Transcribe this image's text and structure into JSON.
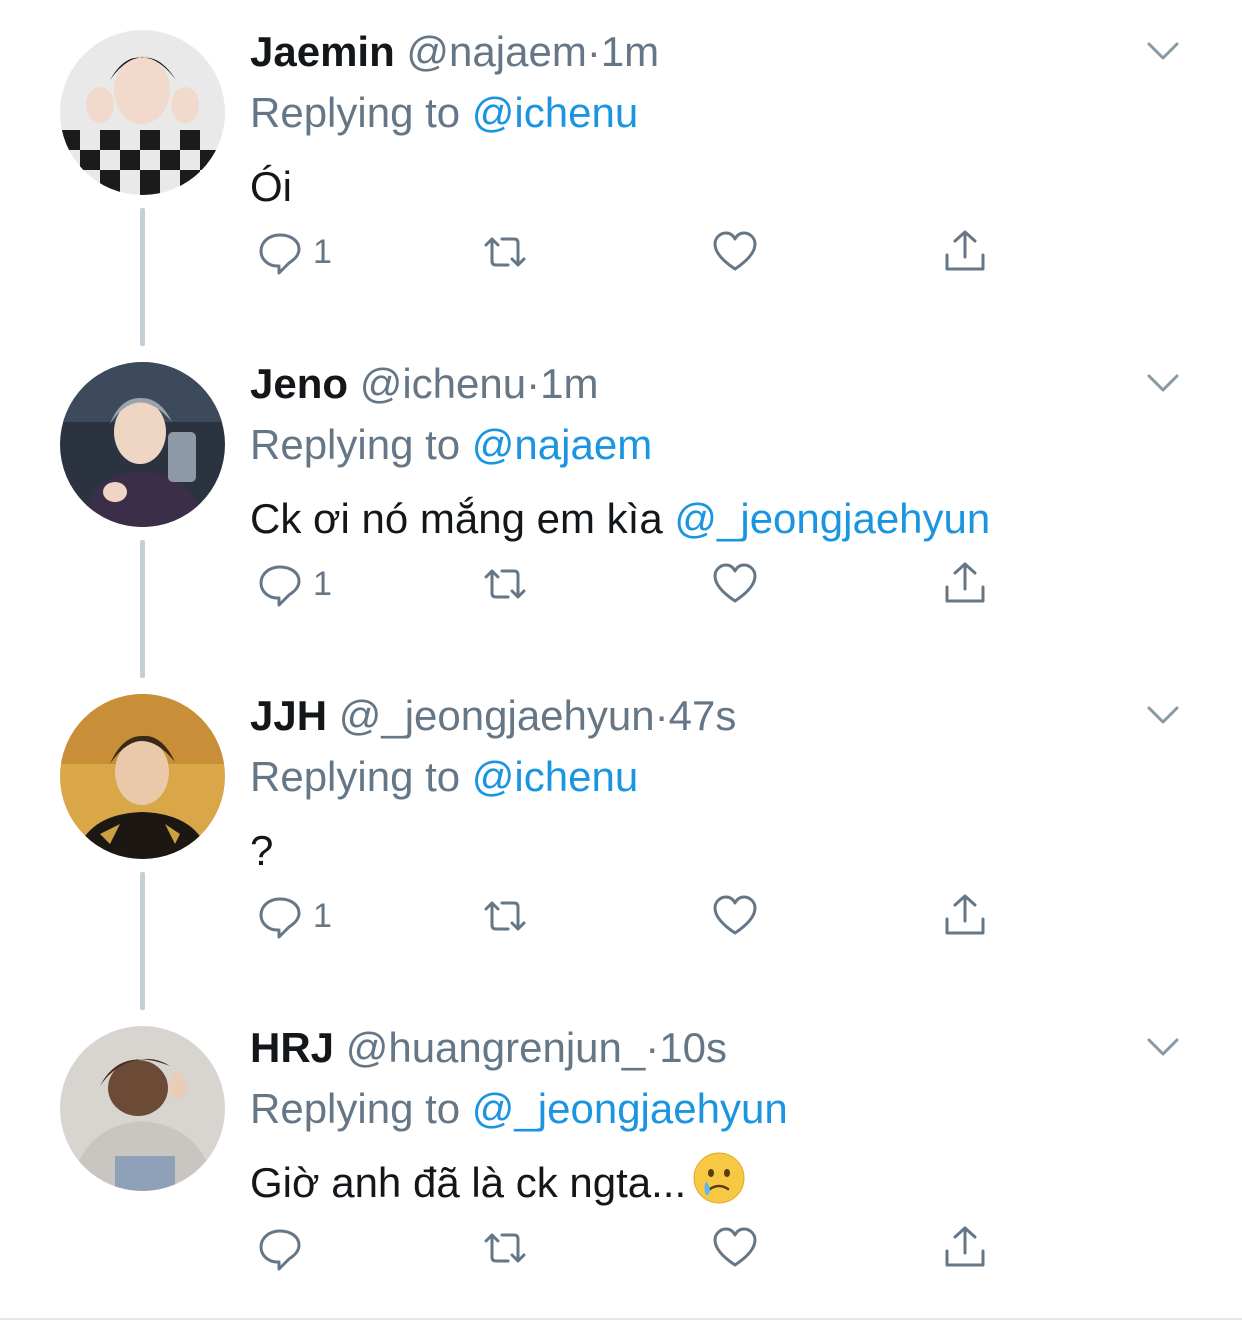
{
  "colors": {
    "text": "#14171a",
    "secondary": "#657786",
    "mention": "#1b95e0",
    "thread_line": "#c4cfd6"
  },
  "tweets": [
    {
      "name": "Jaemin",
      "handle": "@najaem",
      "separator": "·",
      "time": "1m",
      "replying_prefix": "Replying to",
      "replying_to": "@ichenu",
      "text": "Ói",
      "text_mention": "",
      "reply_count": "1"
    },
    {
      "name": "Jeno",
      "handle": "@ichenu",
      "separator": "·",
      "time": "1m",
      "replying_prefix": "Replying to",
      "replying_to": "@najaem",
      "text": "Ck ơi nó mắng em kìa",
      "text_mention": "@_jeongjaehyun",
      "reply_count": "1"
    },
    {
      "name": "JJH",
      "handle": "@_jeongjaehyun",
      "separator": "·",
      "time": "47s",
      "replying_prefix": "Replying to",
      "replying_to": "@ichenu",
      "text": "?",
      "text_mention": "",
      "reply_count": "1"
    },
    {
      "name": "HRJ",
      "handle": "@huangrenjun_",
      "separator": "·",
      "time": "10s",
      "replying_prefix": "Replying to",
      "replying_to": "@_jeongjaehyun",
      "text": "Giờ anh đã là ck ngta...",
      "text_mention": "",
      "reply_count": ""
    }
  ],
  "icons": {
    "reply": "speech-bubble-icon",
    "retweet": "retweet-icon",
    "like": "heart-icon",
    "share": "share-upload-icon",
    "more": "chevron-down-icon",
    "emoji": "crying-face-emoji"
  }
}
